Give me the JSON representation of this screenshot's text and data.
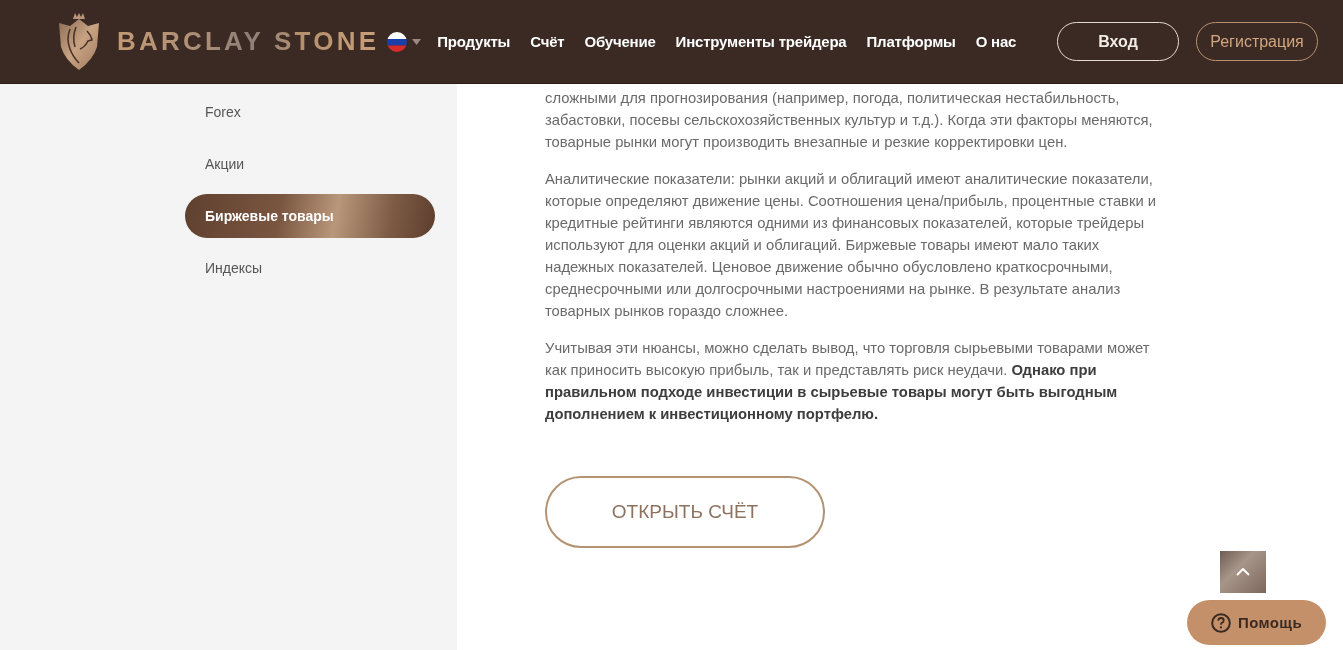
{
  "header": {
    "logo_text": "BARCLAY STONE",
    "nav": [
      "Продукты",
      "Счёт",
      "Обучение",
      "Инструменты трейдера",
      "Платформы",
      "О нас"
    ],
    "login_button": "Вход",
    "register_button": "Регистрация"
  },
  "sidebar": {
    "items": [
      {
        "label": "Forex",
        "selected": false
      },
      {
        "label": "Акции",
        "selected": false
      },
      {
        "label": "Биржевые товары",
        "selected": true
      },
      {
        "label": "Индексы",
        "selected": false
      }
    ]
  },
  "article": {
    "paragraphs": [
      "сложными для прогнозирования (например, погода, политическая нестабильность, забастовки, посевы сельскохозяйственных культур и т.д.). Когда эти факторы меняются, товарные рынки могут производить внезапные и резкие корректировки цен.",
      "Аналитические показатели: рынки акций и облигаций имеют аналитические показатели, которые определяют движение цены. Соотношения цена/прибыль, процентные ставки и кредитные рейтинги являются одними из финансовых показателей, которые трейдеры используют для оценки акций и облигаций. Биржевые товары имеют мало таких надежных показателей. Ценовое движение обычно обусловлено краткосрочными, среднесрочными или долгосрочными настроениями на рынке. В результате анализ товарных рынков гораздо сложнее.",
      "Учитывая эти нюансы, можно сделать вывод, что торговля сырьевыми товарами может как приносить высокую прибыль, так и представлять риск неудачи. **Однако при правильном подходе инвестиции в сырьевые товары могут быть выгодным дополнением к инвестиционному портфелю.**"
    ],
    "cta_button": "ОТКРЫТЬ СЧЁТ"
  },
  "help_button": "Помощь"
}
